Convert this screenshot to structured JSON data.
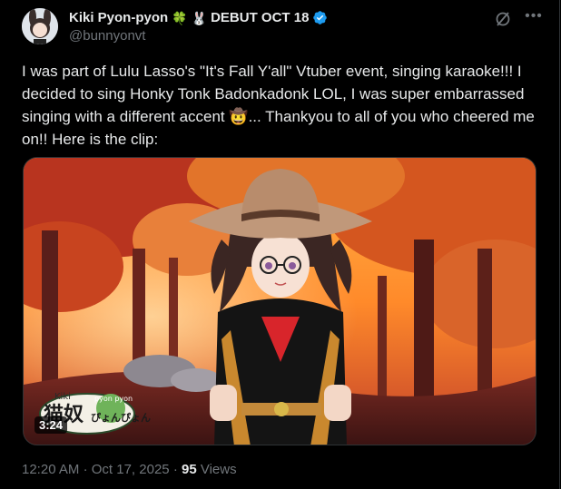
{
  "post": {
    "display_name": "Kiki Pyon-pyon",
    "name_suffix": "DEBUT OCT 18",
    "handle": "@bunnyonvt",
    "verified": true,
    "clover_emoji": "🍀",
    "rabbit_emoji": "🐰",
    "text_part1": "I was part of Lulu Lasso's \"It's Fall Y'all\" Vtuber event, singing karaoke!!! I decided to sing Honky Tonk Badonkadonk LOL, I was super embarrassed singing with a different accent ",
    "cowboy_emoji": "🤠",
    "text_part2": "... Thankyou to all of you who cheered me on!! Here is the clip:",
    "video_duration": "3:24",
    "time": "12:20 AM",
    "separator": "·",
    "date": "Oct 17, 2025",
    "views_count": "95",
    "views_label": "Views"
  },
  "overlay": {
    "logo_top": "Kiki",
    "logo_main": "猫奴",
    "logo_small": "pyon pyon",
    "logo_kana": "ぴょんぴょん"
  },
  "colors": {
    "background": "#000000",
    "text": "#e7e9ea",
    "secondary": "#71767b",
    "verified_blue": "#1d9bf0",
    "border": "#2f3336"
  },
  "icons": {
    "grok": "grok-icon",
    "more": "more-icon",
    "verified": "verified-badge-icon"
  }
}
